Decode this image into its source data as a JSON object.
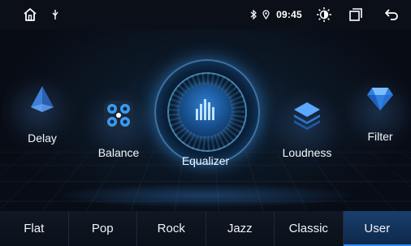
{
  "status": {
    "time": "09:45"
  },
  "icons": {
    "home": "home-icon",
    "usb": "usb-icon",
    "bluetooth": "bluetooth-icon",
    "location": "location-icon",
    "brightness": "brightness-icon",
    "recent_apps": "recent-apps-icon",
    "back": "back-icon"
  },
  "carousel": {
    "delay": "Delay",
    "balance": "Balance",
    "equalizer": "Equalizer",
    "loudness": "Loudness",
    "filter": "Filter"
  },
  "presets": [
    {
      "label": "Flat",
      "active": false
    },
    {
      "label": "Pop",
      "active": false
    },
    {
      "label": "Rock",
      "active": false
    },
    {
      "label": "Jazz",
      "active": false
    },
    {
      "label": "Classic",
      "active": false
    },
    {
      "label": "User",
      "active": true
    }
  ],
  "colors": {
    "accent": "#2d8cff",
    "background": "#0a0e16"
  }
}
